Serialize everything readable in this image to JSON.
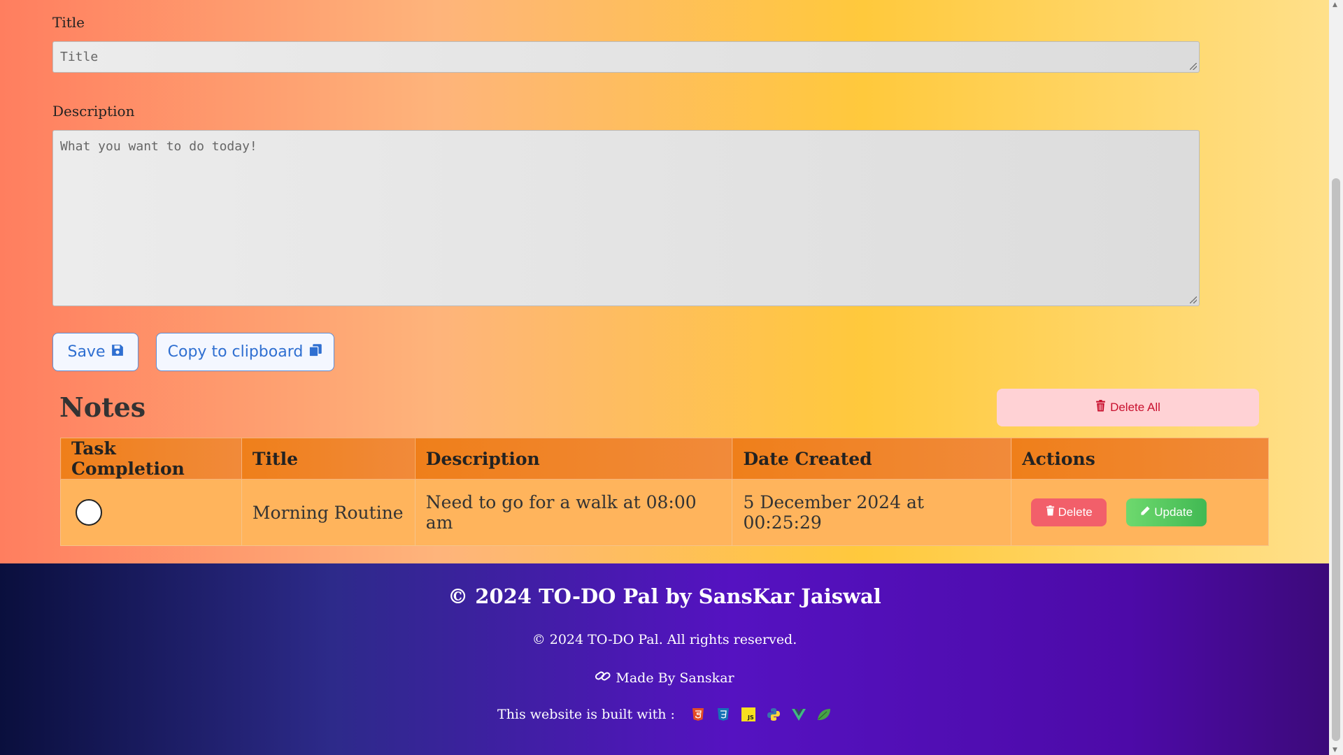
{
  "form": {
    "title_label": "Title",
    "title_placeholder": "Title",
    "description_label": "Description",
    "description_placeholder": "What you want to do today!",
    "save_label": "Save",
    "copy_label": "Copy to clipboard"
  },
  "notes": {
    "heading": "Notes",
    "delete_all_label": "Delete All",
    "columns": [
      "Task Completion",
      "Title",
      "Description",
      "Date Created",
      "Actions"
    ],
    "rows": [
      {
        "title": "Morning Routine",
        "description": "Need to go for a walk at 08:00 am",
        "date_created": "5 December 2024 at 00:25:29",
        "delete_label": "Delete",
        "update_label": "Update"
      }
    ]
  },
  "footer": {
    "title": "© 2024 TO-DO Pal by SansKar Jaiswal",
    "rights": "© 2024 TO-DO Pal. All rights reserved.",
    "made_by": "Made By Sanskar",
    "built_with": "This website is built with :",
    "tech_icons": [
      "html5-icon",
      "css3-icon",
      "javascript-icon",
      "python-icon",
      "vue-icon",
      "mongodb-leaf-icon"
    ]
  },
  "colors": {
    "accent_blue": "#2f6fd1",
    "delete_red": "#f25f6a",
    "update_green": "#41b953",
    "table_header": "#ef7f1a",
    "table_cell": "#ffb45c"
  }
}
